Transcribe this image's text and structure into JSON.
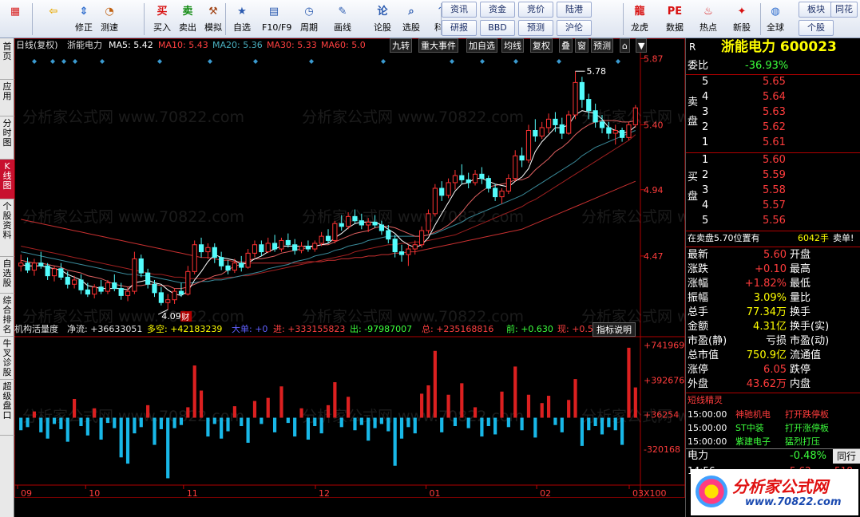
{
  "toolbar": {
    "buttons": [
      {
        "label": "",
        "icon": "windows-icon",
        "glyph": "▦",
        "color": "#d82020"
      },
      {
        "label": "",
        "icon": "back-arrow-icon",
        "glyph": "⇦",
        "color": "#e8a800"
      },
      {
        "label": "修正",
        "icon": "up-down-arrow-icon",
        "glyph": "⇕",
        "color": "#2a6acd"
      },
      {
        "label": "测速",
        "icon": "clock-icon",
        "glyph": "◔",
        "color": "#c06010"
      },
      {
        "label": "买入",
        "icon": "buy-icon",
        "glyph": "买",
        "color": "#d81010"
      },
      {
        "label": "卖出",
        "icon": "sell-icon",
        "glyph": "卖",
        "color": "#108a10"
      },
      {
        "label": "模拟",
        "icon": "hammer-icon",
        "glyph": "⚒",
        "color": "#a04010"
      },
      {
        "label": "自选",
        "icon": "star-icon",
        "glyph": "★",
        "color": "#2a5ab0"
      },
      {
        "label": "F10/F9",
        "icon": "f10-icon",
        "glyph": "▤",
        "color": "#2a5ab0"
      },
      {
        "label": "周期",
        "icon": "cycle-clock-icon",
        "glyph": "◷",
        "color": "#2a5ab0"
      },
      {
        "label": "画线",
        "icon": "pencil-icon",
        "glyph": "✎",
        "color": "#2a5ab0"
      },
      {
        "label": "论股",
        "icon": "discuss-icon",
        "glyph": "论",
        "color": "#2a5ab0"
      },
      {
        "label": "选股",
        "icon": "magnifier-icon",
        "glyph": "⌕",
        "color": "#2a5ab0"
      },
      {
        "label": "科创",
        "icon": "sci-tech-icon",
        "glyph": "〽",
        "color": "#2a5ab0"
      },
      {
        "label": "龙虎",
        "icon": "dragon-icon",
        "glyph": "龍",
        "color": "#d81010"
      },
      {
        "label": "数据",
        "icon": "pe-icon",
        "glyph": "PE",
        "color": "#d81010"
      },
      {
        "label": "热点",
        "icon": "hot-icon",
        "glyph": "♨",
        "color": "#d81010"
      },
      {
        "label": "新股",
        "icon": "new-stock-icon",
        "glyph": "✦",
        "color": "#d81010"
      },
      {
        "label": "全球",
        "icon": "globe-icon",
        "glyph": "◍",
        "color": "#2a6acd"
      }
    ],
    "small_buttons": [
      "资讯",
      "资金",
      "竞价",
      "陆港",
      "研报",
      "BBD",
      "预测",
      "沪伦",
      "板块",
      "个股",
      "同花"
    ]
  },
  "sidebar": {
    "tabs": [
      "首页",
      "应用",
      "分时图",
      "K线图",
      "个股资料",
      "自选股",
      "综合排名",
      "牛叉诊股",
      "超级盘口"
    ],
    "active": "K线图"
  },
  "kline_header": {
    "period": "日线(复权)",
    "name": "浙能电力",
    "ma5": "MA5: 5.42",
    "ma10": "MA10: 5.43",
    "ma20": "MA20: 5.36",
    "ma30": "MA30: 5.33",
    "ma60": "MA60: 5.0",
    "buttons": [
      "九转",
      "重大事件",
      "加自选",
      "均线",
      "复权",
      "叠",
      "窗",
      "预测",
      "⌂",
      "▼"
    ]
  },
  "indicator_header": {
    "name": "机构活量度",
    "net": "净流: +36633051",
    "ls": "多空: +42183239",
    "big": "大单: +0",
    "in": "进: +333155823",
    "out": "出: -97987007",
    "total": "总: +235168816",
    "prev": "前: +0.630",
    "now": "现: +0.5(",
    "help": "指标说明"
  },
  "price_axis": [
    "5.87",
    "5.40",
    "4.94",
    "4.47"
  ],
  "vol_axis": [
    "+741969",
    "+392676",
    "+36254",
    "-320168",
    "X100"
  ],
  "month_labels": [
    "09",
    "10",
    "11",
    "12",
    "01",
    "02",
    "03"
  ],
  "annotations": {
    "high": "5.78",
    "low": "4.09",
    "cai": "财"
  },
  "chart_data": {
    "type": "candlestick",
    "title": "浙能电力",
    "ylim": [
      4.0,
      5.9
    ],
    "high_label": 5.78,
    "low_label": 4.09,
    "ohlc": [
      [
        4.4,
        4.48,
        4.36,
        4.42
      ],
      [
        4.42,
        4.46,
        4.35,
        4.37
      ],
      [
        4.37,
        4.45,
        4.33,
        4.42
      ],
      [
        4.42,
        4.5,
        4.38,
        4.4
      ],
      [
        4.4,
        4.42,
        4.3,
        4.33
      ],
      [
        4.33,
        4.4,
        4.29,
        4.38
      ],
      [
        4.38,
        4.42,
        4.3,
        4.32
      ],
      [
        4.32,
        4.36,
        4.24,
        4.27
      ],
      [
        4.27,
        4.33,
        4.24,
        4.3
      ],
      [
        4.3,
        4.34,
        4.2,
        4.23
      ],
      [
        4.23,
        4.28,
        4.18,
        4.2
      ],
      [
        4.2,
        4.27,
        4.17,
        4.25
      ],
      [
        4.25,
        4.3,
        4.2,
        4.22
      ],
      [
        4.22,
        4.3,
        4.2,
        4.28
      ],
      [
        4.28,
        4.34,
        4.22,
        4.24
      ],
      [
        4.24,
        4.28,
        4.16,
        4.19
      ],
      [
        4.19,
        4.25,
        4.15,
        4.22
      ],
      [
        4.22,
        4.5,
        4.2,
        4.45
      ],
      [
        4.45,
        4.48,
        4.32,
        4.35
      ],
      [
        4.35,
        4.38,
        4.24,
        4.27
      ],
      [
        4.27,
        4.3,
        4.18,
        4.21
      ],
      [
        4.21,
        4.25,
        4.12,
        4.14
      ],
      [
        4.14,
        4.2,
        4.09,
        4.16
      ],
      [
        4.16,
        4.24,
        4.13,
        4.22
      ],
      [
        4.22,
        4.28,
        4.18,
        4.2
      ],
      [
        4.2,
        4.4,
        4.19,
        4.36
      ],
      [
        4.36,
        4.58,
        4.34,
        4.55
      ],
      [
        4.55,
        4.6,
        4.46,
        4.5
      ],
      [
        4.5,
        4.56,
        4.45,
        4.53
      ],
      [
        4.53,
        4.56,
        4.42,
        4.46
      ],
      [
        4.46,
        4.5,
        4.37,
        4.4
      ],
      [
        4.4,
        4.44,
        4.34,
        4.37
      ],
      [
        4.37,
        4.45,
        4.35,
        4.42
      ],
      [
        4.42,
        4.47,
        4.36,
        4.39
      ],
      [
        4.39,
        4.52,
        4.38,
        4.49
      ],
      [
        4.49,
        4.58,
        4.46,
        4.55
      ],
      [
        4.55,
        4.58,
        4.47,
        4.5
      ],
      [
        4.5,
        4.6,
        4.49,
        4.56
      ],
      [
        4.56,
        4.62,
        4.5,
        4.52
      ],
      [
        4.52,
        4.6,
        4.5,
        4.58
      ],
      [
        4.58,
        4.63,
        4.53,
        4.55
      ],
      [
        4.55,
        4.59,
        4.48,
        4.51
      ],
      [
        4.51,
        4.57,
        4.49,
        4.54
      ],
      [
        4.54,
        4.58,
        4.5,
        4.52
      ],
      [
        4.52,
        4.58,
        4.5,
        4.56
      ],
      [
        4.56,
        4.64,
        4.54,
        4.61
      ],
      [
        4.61,
        4.66,
        4.56,
        4.58
      ],
      [
        4.58,
        4.72,
        4.56,
        4.7
      ],
      [
        4.7,
        4.76,
        4.65,
        4.68
      ],
      [
        4.68,
        4.78,
        4.66,
        4.75
      ],
      [
        4.75,
        4.8,
        4.7,
        4.72
      ],
      [
        4.72,
        4.77,
        4.66,
        4.69
      ],
      [
        4.69,
        4.74,
        4.64,
        4.71
      ],
      [
        4.71,
        4.76,
        4.67,
        4.69
      ],
      [
        4.69,
        4.72,
        4.62,
        4.65
      ],
      [
        4.65,
        4.69,
        4.56,
        4.59
      ],
      [
        4.59,
        4.62,
        4.46,
        4.5
      ],
      [
        4.5,
        4.55,
        4.43,
        4.48
      ],
      [
        4.48,
        4.55,
        4.4,
        4.52
      ],
      [
        4.52,
        4.58,
        4.48,
        4.55
      ],
      [
        4.55,
        4.68,
        4.53,
        4.65
      ],
      [
        4.65,
        4.8,
        4.63,
        4.77
      ],
      [
        4.77,
        4.98,
        4.75,
        4.95
      ],
      [
        4.95,
        5.0,
        4.86,
        4.9
      ],
      [
        4.9,
        5.02,
        4.88,
        4.99
      ],
      [
        4.99,
        5.08,
        4.94,
        5.04
      ],
      [
        5.04,
        5.12,
        4.98,
        5.01
      ],
      [
        5.01,
        5.06,
        4.95,
        4.99
      ],
      [
        4.99,
        5.08,
        4.97,
        5.05
      ],
      [
        5.05,
        5.1,
        4.98,
        5.02
      ],
      [
        5.02,
        5.04,
        4.92,
        4.95
      ],
      [
        4.95,
        4.98,
        4.86,
        4.89
      ],
      [
        4.89,
        4.95,
        4.84,
        4.93
      ],
      [
        4.93,
        5.05,
        4.91,
        5.02
      ],
      [
        5.02,
        5.22,
        5.0,
        5.18
      ],
      [
        5.18,
        5.24,
        5.1,
        5.15
      ],
      [
        5.15,
        5.4,
        5.13,
        5.36
      ],
      [
        5.36,
        5.44,
        5.28,
        5.32
      ],
      [
        5.32,
        5.42,
        5.3,
        5.38
      ],
      [
        5.38,
        5.48,
        5.34,
        5.44
      ],
      [
        5.44,
        5.49,
        5.35,
        5.4
      ],
      [
        5.4,
        5.45,
        5.3,
        5.34
      ],
      [
        5.34,
        5.5,
        5.33,
        5.47
      ],
      [
        5.47,
        5.78,
        5.44,
        5.7
      ],
      [
        5.7,
        5.74,
        5.52,
        5.58
      ],
      [
        5.58,
        5.62,
        5.44,
        5.5
      ],
      [
        5.5,
        5.55,
        5.38,
        5.42
      ],
      [
        5.42,
        5.47,
        5.34,
        5.38
      ],
      [
        5.38,
        5.42,
        5.3,
        5.34
      ],
      [
        5.34,
        5.4,
        5.26,
        5.36
      ],
      [
        5.36,
        5.38,
        5.28,
        5.31
      ],
      [
        5.31,
        5.42,
        5.29,
        5.4
      ],
      [
        5.4,
        5.54,
        5.38,
        5.52
      ]
    ],
    "ma5": [
      4.41,
      4.4,
      4.4,
      4.4,
      4.39,
      4.38,
      4.37,
      4.34,
      4.32,
      4.3,
      4.26,
      4.25,
      4.24,
      4.24,
      4.24,
      4.24,
      4.23,
      4.28,
      4.29,
      4.3,
      4.28,
      4.27,
      4.23,
      4.2,
      4.19,
      4.22,
      4.3,
      4.36,
      4.43,
      4.48,
      4.46,
      4.45,
      4.44,
      4.41,
      4.42,
      4.45,
      4.47,
      4.5,
      4.52,
      4.54,
      4.54,
      4.54,
      4.54,
      4.54,
      4.54,
      4.55,
      4.56,
      4.6,
      4.63,
      4.67,
      4.7,
      4.71,
      4.71,
      4.71,
      4.69,
      4.66,
      4.63,
      4.58,
      4.55,
      4.53,
      4.55,
      4.6,
      4.69,
      4.77,
      4.85,
      4.93,
      4.98,
      4.99,
      5.02,
      5.02,
      5.0,
      4.98,
      4.97,
      4.96,
      5.0,
      5.03,
      5.09,
      5.21,
      5.28,
      5.33,
      5.38,
      5.38,
      5.4,
      5.47,
      5.5,
      5.49,
      5.48,
      5.44,
      5.38,
      5.36,
      5.34,
      5.35,
      5.39
    ],
    "ma10": [
      4.44,
      4.43,
      4.42,
      4.42,
      4.41,
      4.4,
      4.39,
      4.37,
      4.36,
      4.35,
      4.33,
      4.32,
      4.31,
      4.29,
      4.27,
      4.26,
      4.25,
      4.26,
      4.26,
      4.27,
      4.27,
      4.26,
      4.26,
      4.24,
      4.24,
      4.25,
      4.27,
      4.29,
      4.31,
      4.33,
      4.34,
      4.37,
      4.4,
      4.41,
      4.44,
      4.45,
      4.45,
      4.46,
      4.47,
      4.49,
      4.5,
      4.51,
      4.52,
      4.53,
      4.54,
      4.55,
      4.55,
      4.57,
      4.59,
      4.61,
      4.63,
      4.64,
      4.65,
      4.67,
      4.68,
      4.68,
      4.67,
      4.65,
      4.63,
      4.61,
      4.61,
      4.62,
      4.64,
      4.66,
      4.69,
      4.73,
      4.78,
      4.84,
      4.89,
      4.93,
      4.96,
      4.97,
      4.98,
      4.99,
      5.01,
      5.01,
      5.03,
      5.08,
      5.12,
      5.16,
      5.21,
      5.24,
      5.28,
      5.33,
      5.37,
      5.4,
      5.42,
      5.43,
      5.43,
      5.43,
      5.42,
      5.42,
      5.43
    ],
    "ma20": [
      4.5,
      4.49,
      4.48,
      4.47,
      4.46,
      4.45,
      4.44,
      4.43,
      4.42,
      4.41,
      4.4,
      4.39,
      4.38,
      4.37,
      4.36,
      4.35,
      4.34,
      4.34,
      4.33,
      4.33,
      4.32,
      4.31,
      4.3,
      4.29,
      4.28,
      4.28,
      4.28,
      4.29,
      4.29,
      4.3,
      4.3,
      4.31,
      4.32,
      4.33,
      4.34,
      4.35,
      4.36,
      4.38,
      4.39,
      4.4,
      4.41,
      4.43,
      4.44,
      4.45,
      4.47,
      4.48,
      4.49,
      4.51,
      4.52,
      4.54,
      4.55,
      4.56,
      4.58,
      4.59,
      4.6,
      4.61,
      4.61,
      4.61,
      4.61,
      4.61,
      4.61,
      4.62,
      4.63,
      4.65,
      4.67,
      4.69,
      4.71,
      4.74,
      4.76,
      4.78,
      4.8,
      4.82,
      4.84,
      4.86,
      4.88,
      4.9,
      4.93,
      4.96,
      4.99,
      5.02,
      5.05,
      5.08,
      5.11,
      5.14,
      5.18,
      5.21,
      5.24,
      5.26,
      5.28,
      5.3,
      5.32,
      5.34,
      5.36
    ],
    "ma30": [
      4.54,
      4.53,
      4.52,
      4.51,
      4.5,
      4.49,
      4.48,
      4.47,
      4.46,
      4.45,
      4.44,
      4.43,
      4.42,
      4.41,
      4.4,
      4.39,
      4.38,
      4.37,
      4.36,
      4.35,
      4.34,
      4.34,
      4.33,
      4.32,
      4.32,
      4.31,
      4.31,
      4.31,
      4.31,
      4.31,
      4.31,
      4.32,
      4.32,
      4.33,
      4.33,
      4.34,
      4.35,
      4.36,
      4.37,
      4.38,
      4.39,
      4.4,
      4.41,
      4.42,
      4.43,
      4.44,
      4.45,
      4.46,
      4.47,
      4.48,
      4.5,
      4.51,
      4.52,
      4.53,
      4.54,
      4.55,
      4.55,
      4.56,
      4.56,
      4.57,
      4.57,
      4.58,
      4.59,
      4.6,
      4.61,
      4.62,
      4.64,
      4.66,
      4.68,
      4.7,
      4.72,
      4.74,
      4.76,
      4.78,
      4.8,
      4.82,
      4.85,
      4.87,
      4.9,
      4.93,
      4.96,
      4.99,
      5.02,
      5.05,
      5.08,
      5.11,
      5.14,
      5.17,
      5.2,
      5.23,
      5.26,
      5.29,
      5.33
    ],
    "ma60": [
      4.73,
      4.72,
      4.71,
      4.7,
      4.69,
      4.68,
      4.67,
      4.66,
      4.65,
      4.64,
      4.63,
      4.62,
      4.61,
      4.6,
      4.59,
      4.58,
      4.57,
      4.56,
      4.55,
      4.54,
      4.53,
      4.52,
      4.51,
      4.5,
      4.49,
      4.48,
      4.47,
      4.46,
      4.46,
      4.45,
      4.44,
      4.44,
      4.43,
      4.43,
      4.42,
      4.42,
      4.42,
      4.42,
      4.42,
      4.42,
      4.42,
      4.42,
      4.42,
      4.43,
      4.43,
      4.43,
      4.44,
      4.44,
      4.45,
      4.45,
      4.46,
      4.46,
      4.47,
      4.47,
      4.48,
      4.48,
      4.49,
      4.49,
      4.5,
      4.5,
      4.51,
      4.52,
      4.53,
      4.54,
      4.55,
      4.56,
      4.57,
      4.58,
      4.59,
      4.6,
      4.61,
      4.62,
      4.63,
      4.64,
      4.65,
      4.66,
      4.68,
      4.7,
      4.72,
      4.74,
      4.76,
      4.78,
      4.8,
      4.82,
      4.84,
      4.86,
      4.88,
      4.9,
      4.92,
      4.94,
      4.96,
      4.98,
      5.0
    ],
    "indicator_values": [
      -1.2,
      -0.9,
      0.6,
      -1.4,
      -2.0,
      -0.6,
      -1.1,
      -2.3,
      1.8,
      -0.8,
      -1.7,
      0.9,
      -2.1,
      -0.5,
      -1.0,
      -3.8,
      -4.4,
      -1.5,
      -0.9,
      1.2,
      -2.6,
      -1.1,
      -5.8,
      -1.0,
      -0.7,
      1.0,
      5.0,
      2.6,
      -1.8,
      -0.6,
      -2.0,
      -1.3,
      1.1,
      -0.8,
      -2.4,
      1.6,
      -0.6,
      1.9,
      -1.4,
      3.0,
      -0.5,
      -1.8,
      0.9,
      -2.1,
      -0.8,
      -1.5,
      1.2,
      3.4,
      -0.9,
      2.0,
      -1.2,
      -0.7,
      -2.2,
      -1.0,
      -0.6,
      -1.3,
      -4.6,
      -2.0,
      -0.9,
      -1.5,
      2.3,
      3.1,
      6.4,
      -1.4,
      2.2,
      -0.8,
      3.3,
      -1.0,
      1.0,
      -1.8,
      -0.8,
      -1.6,
      2.5,
      -0.9,
      4.9,
      -1.2,
      2.2,
      -1.9,
      1.4,
      2.1,
      -0.7,
      -1.4,
      1.7,
      3.7,
      -2.7,
      -1.2,
      -0.8,
      -1.6,
      -0.9,
      -1.2,
      -2.6,
      6.7,
      2.9
    ]
  },
  "quote": {
    "title": "浙能电力 600023",
    "r": "R",
    "webi_label": "委比",
    "webi_value": "-36.93%",
    "sell_label": [
      "卖",
      "盘"
    ],
    "buy_label": [
      "买",
      "盘"
    ],
    "sell": [
      [
        "5",
        "5.65"
      ],
      [
        "4",
        "5.64"
      ],
      [
        "3",
        "5.63"
      ],
      [
        "2",
        "5.62"
      ],
      [
        "1",
        "5.61"
      ]
    ],
    "buy": [
      [
        "1",
        "5.60"
      ],
      [
        "2",
        "5.59"
      ],
      [
        "3",
        "5.58"
      ],
      [
        "4",
        "5.57"
      ],
      [
        "5",
        "5.56"
      ]
    ],
    "notice_text": "在卖盘5.70位置有",
    "notice_qty": "6042手",
    "notice_tag": "卖单!",
    "stats": [
      [
        "最新",
        "5.60",
        "开盘",
        "red"
      ],
      [
        "涨跌",
        "+0.10",
        "最高",
        "red"
      ],
      [
        "涨幅",
        "+1.82%",
        "最低",
        "red"
      ],
      [
        "振幅",
        "3.09%",
        "量比",
        "yel"
      ],
      [
        "总手",
        "77.34万",
        "换手",
        "yel"
      ],
      [
        "金额",
        "4.31亿",
        "换手(实)",
        "yel"
      ],
      [
        "市盈(静)",
        "亏损",
        "市盈(动)",
        "white"
      ],
      [
        "总市值",
        "750.9亿",
        "流通值",
        "yel"
      ],
      [
        "涨停",
        "6.05",
        "跌停",
        "red"
      ],
      [
        "外盘",
        "43.62万",
        "内盘",
        "red"
      ]
    ],
    "elf_title": "短线精灵",
    "elf": [
      [
        "15:00:00",
        "神驰机电",
        "打开跌停板",
        "red"
      ],
      [
        "15:00:00",
        "ST中装",
        "打开涨停板",
        "green"
      ],
      [
        "15:00:00",
        "紫建电子",
        "猛烈打压",
        "green"
      ]
    ],
    "bottom_name": "电力",
    "bottom_pct": "-0.48%",
    "bottom_tab": "同行",
    "tick_time": "14:56",
    "tick_price": "5.62",
    "tick_vol": "518"
  },
  "logo": {
    "text": "分析家公式网",
    "url": "www.70822.com"
  },
  "watermark": "分析家公式网 www.70822.com"
}
